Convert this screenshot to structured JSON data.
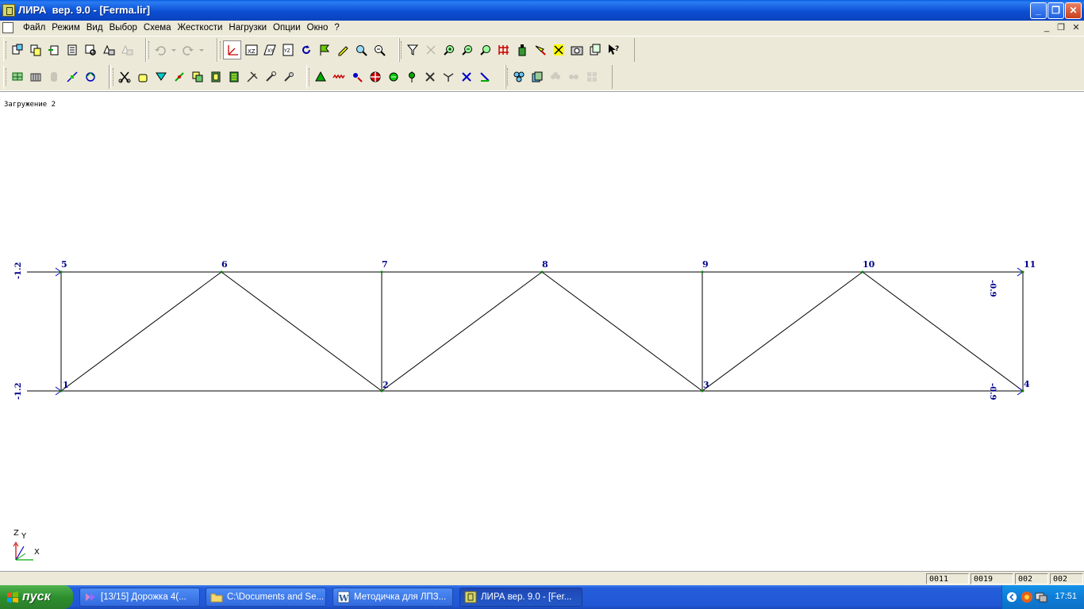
{
  "window": {
    "title": "ЛИРА  вер. 9.0 - [Ferma.lir]",
    "min": "_",
    "max": "❐",
    "close": "✕"
  },
  "menu": {
    "items": [
      "Файл",
      "Режим",
      "Вид",
      "Выбор",
      "Схема",
      "Жесткости",
      "Нагрузки",
      "Опции",
      "Окно",
      "?"
    ],
    "mdi_min": "_",
    "mdi_restore": "❐",
    "mdi_close": "✕"
  },
  "canvas": {
    "load_case": "Загружение 2",
    "nodes": [
      "1",
      "2",
      "3",
      "4",
      "5",
      "6",
      "7",
      "8",
      "9",
      "10",
      "11"
    ],
    "loads": [
      "-1.2",
      "-1.2",
      "-0.9",
      "-0.9"
    ],
    "axes": {
      "z": "Z",
      "y": "Y",
      "x": "X"
    },
    "colors": {
      "members": "#000000",
      "nodes": "#00008b",
      "loads": "#0000cd",
      "node_dot": "#008000"
    }
  },
  "status": {
    "cells": [
      "0011",
      "0019",
      "002",
      "002"
    ]
  },
  "taskbar": {
    "start": "пуск",
    "tasks": [
      {
        "label": "[13/15] Дорожка 4(...",
        "icon": "media-player-icon"
      },
      {
        "label": "C:\\Documents and Se...",
        "icon": "folder-icon"
      },
      {
        "label": "Методичка для ЛПЗ...",
        "icon": "word-icon"
      },
      {
        "label": "ЛИРА  вер. 9.0 - [Fer...",
        "icon": "lira-icon"
      }
    ],
    "clock": "17:51"
  }
}
